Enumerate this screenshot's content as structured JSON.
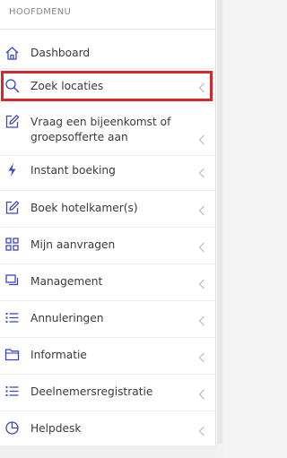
{
  "menu": {
    "header": "HOOFDMENU",
    "items": [
      {
        "label": "Dashboard",
        "icon": "home-icon",
        "has_chevron": false
      },
      {
        "label": "Zoek locaties",
        "icon": "search-icon",
        "has_chevron": true,
        "highlighted": true
      },
      {
        "label_line1": "Vraag een bijeenkomst of",
        "label_line2": "groepsofferte aan",
        "icon": "edit-icon",
        "has_chevron": true
      },
      {
        "label": "Instant boeking",
        "icon": "lightning-icon",
        "has_chevron": true
      },
      {
        "label": "Boek hotelkamer(s)",
        "icon": "edit-icon",
        "has_chevron": true
      },
      {
        "label": "Mijn aanvragen",
        "icon": "grid-icon",
        "has_chevron": true
      },
      {
        "label": "Management",
        "icon": "copy-icon",
        "has_chevron": true
      },
      {
        "label": "Annuleringen",
        "icon": "list-icon",
        "has_chevron": true
      },
      {
        "label": "Informatie",
        "icon": "folder-icon",
        "has_chevron": true
      },
      {
        "label": "Deelnemersregistratie",
        "icon": "list-icon",
        "has_chevron": true
      },
      {
        "label": "Helpdesk",
        "icon": "pie-chart-icon",
        "has_chevron": true
      }
    ]
  },
  "colors": {
    "icon": "#3b44c2",
    "text": "#3a3a3a",
    "header": "#888888",
    "highlight_border": "#d8262c",
    "chevron": "#b5b5b5"
  }
}
